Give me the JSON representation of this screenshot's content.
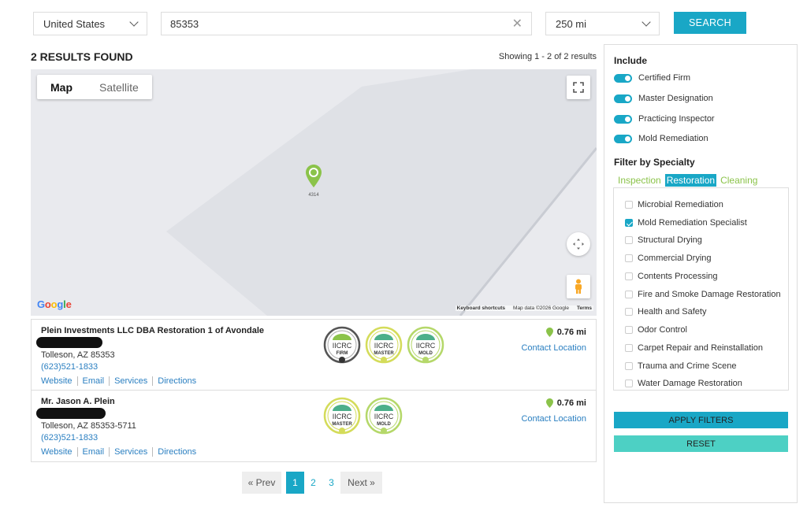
{
  "search": {
    "country": "United States",
    "zip": "85353",
    "radius": "250 mi",
    "button": "SEARCH"
  },
  "results": {
    "count_label": "2 RESULTS FOUND",
    "showing": "Showing 1 - 2 of 2 results",
    "items": [
      {
        "name": "Plein Investments LLC DBA Restoration 1 of Avondale",
        "city": "Tolleson, AZ 85353",
        "phone": "(623)521-1833",
        "distance": "0.76 mi",
        "contact": "Contact Location",
        "links": [
          "Website",
          "Email",
          "Services",
          "Directions"
        ],
        "badges": [
          "FIRM",
          "MASTER",
          "MOLD"
        ]
      },
      {
        "name": "Mr. Jason A. Plein",
        "city": "Tolleson, AZ 85353-5711",
        "phone": "(623)521-1833",
        "distance": "0.76 mi",
        "contact": "Contact Location",
        "links": [
          "Website",
          "Email",
          "Services",
          "Directions"
        ],
        "badges": [
          "MASTER",
          "MOLD"
        ]
      }
    ]
  },
  "map": {
    "tab_map": "Map",
    "tab_satellite": "Satellite",
    "google": "Google",
    "keyboard": "Keyboard shortcuts",
    "mapdata": "Map data ©2026 Google",
    "terms": "Terms",
    "pin_label": "4314",
    "badge_brand": "IICRC",
    "colors": {
      "pin": "#8bc34a",
      "land": "#e9eaee",
      "block": "#dfe1e6"
    }
  },
  "pagination": {
    "prev": "« Prev",
    "pages": [
      "1",
      "2",
      "3"
    ],
    "next": "Next »",
    "current": "1"
  },
  "filters": {
    "include_title": "Include",
    "include": [
      "Certified Firm",
      "Master Designation",
      "Practicing Inspector",
      "Mold Remediation"
    ],
    "specialty_title": "Filter by Specialty",
    "tabs": [
      "Inspection",
      "Restoration",
      "Cleaning"
    ],
    "active_tab": "Restoration",
    "specialties": [
      {
        "label": "Microbial Remediation",
        "checked": false
      },
      {
        "label": "Mold Remediation Specialist",
        "checked": true
      },
      {
        "label": "Structural Drying",
        "checked": false
      },
      {
        "label": "Commercial Drying",
        "checked": false
      },
      {
        "label": "Contents Processing",
        "checked": false
      },
      {
        "label": "Fire and Smoke Damage Restoration",
        "checked": false
      },
      {
        "label": "Health and Safety",
        "checked": false
      },
      {
        "label": "Odor Control",
        "checked": false
      },
      {
        "label": "Carpet Repair and Reinstallation",
        "checked": false
      },
      {
        "label": "Trauma and Crime Scene",
        "checked": false
      },
      {
        "label": "Water Damage Restoration",
        "checked": false
      }
    ],
    "apply": "APPLY FILTERS",
    "reset": "RESET"
  },
  "accent": "#19a7c6"
}
